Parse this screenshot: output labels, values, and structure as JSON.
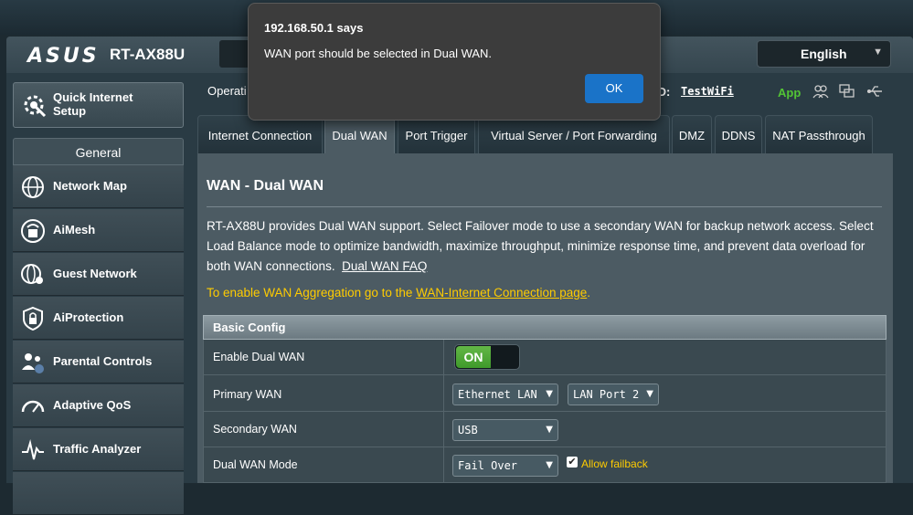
{
  "dialog": {
    "title": "192.168.50.1 says",
    "message": "WAN port should be selected in Dual WAN.",
    "ok_label": "OK"
  },
  "header": {
    "logo": "ASUS",
    "model": "RT-AX88U",
    "language": "English"
  },
  "status": {
    "operation_label": "Operati",
    "ssid_label": "ID:",
    "ssid_value": "TestWiFi",
    "app_label": "App"
  },
  "sidebar": {
    "quick_setup": "Quick Internet Setup",
    "general_label": "General",
    "items": [
      {
        "label": "Network Map",
        "icon": "network-map-icon"
      },
      {
        "label": "AiMesh",
        "icon": "aimesh-icon"
      },
      {
        "label": "Guest Network",
        "icon": "guest-network-icon"
      },
      {
        "label": "AiProtection",
        "icon": "aiprotection-icon"
      },
      {
        "label": "Parental Controls",
        "icon": "parental-controls-icon"
      },
      {
        "label": "Adaptive QoS",
        "icon": "adaptive-qos-icon"
      },
      {
        "label": "Traffic Analyzer",
        "icon": "traffic-analyzer-icon"
      }
    ]
  },
  "tabs": [
    {
      "label": "Internet Connection",
      "active": false
    },
    {
      "label": "Dual WAN",
      "active": true
    },
    {
      "label": "Port Trigger",
      "active": false
    },
    {
      "label": "Virtual Server / Port Forwarding",
      "active": false
    },
    {
      "label": "DMZ",
      "active": false
    },
    {
      "label": "DDNS",
      "active": false
    },
    {
      "label": "NAT Passthrough",
      "active": false
    }
  ],
  "main": {
    "title": "WAN - Dual WAN",
    "description": "RT-AX88U provides Dual WAN support. Select Failover mode to use a secondary WAN for backup network access. Select Load Balance mode to optimize bandwidth, maximize throughput, minimize response time, and prevent data overload for both WAN connections.",
    "faq_link": "Dual WAN FAQ",
    "agg_text": "To enable WAN Aggregation go to the ",
    "agg_link": "WAN-Internet Connection page",
    "agg_end": "."
  },
  "basic_config": {
    "header": "Basic Config",
    "enable_dual_wan": {
      "label": "Enable Dual WAN",
      "value": "ON"
    },
    "primary_wan": {
      "label": "Primary WAN",
      "value": "Ethernet LAN",
      "port": "LAN Port 2"
    },
    "secondary_wan": {
      "label": "Secondary WAN",
      "value": "USB"
    },
    "dual_wan_mode": {
      "label": "Dual WAN Mode",
      "value": "Fail Over",
      "allow_failback": "Allow failback"
    }
  },
  "colors": {
    "accent_green": "#53c435",
    "link_yellow": "#ffcc00",
    "ok_blue": "#1a73c8"
  }
}
